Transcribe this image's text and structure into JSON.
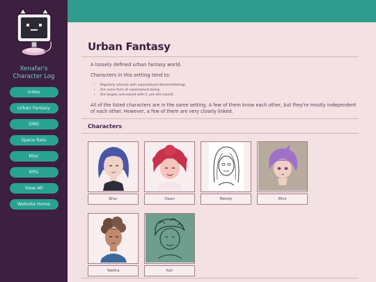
{
  "site": {
    "title_line1": "Xenafar's",
    "title_line2": "Character Log"
  },
  "nav": [
    {
      "label": "Index"
    },
    {
      "label": "Urban Fantasy"
    },
    {
      "label": "DND"
    },
    {
      "label": "Space Rats"
    },
    {
      "label": "Misc"
    },
    {
      "label": "RPG"
    },
    {
      "label": "View All"
    },
    {
      "label": "Website Home"
    }
  ],
  "page": {
    "title": "Urban Fantasy",
    "intro": "A loosely defined urban fantasy world.",
    "tend_to": "Characters in this setting tend to:",
    "bullets": [
      "Regularly interact with supernatural elements/beings",
      "Are some form of supernatural being",
      "Are largely uninvolved with it, yet still coexist."
    ],
    "summary": "All of the listed characters are in the same setting. A few of them know each other, but they're mostly independent of each other. However, a few of them are very closely linked.",
    "section_title": "Characters"
  },
  "characters": [
    {
      "name": "Briar"
    },
    {
      "name": "Owari"
    },
    {
      "name": "Melody"
    },
    {
      "name": "Mimi"
    },
    {
      "name": "Tabitha"
    },
    {
      "name": "Kali"
    }
  ],
  "colors": {
    "sidebar": "#3d1f40",
    "accent": "#2aa292",
    "topbar": "#2f9c8e",
    "background": "#f4e1e3",
    "title": "#6fd4c5"
  }
}
